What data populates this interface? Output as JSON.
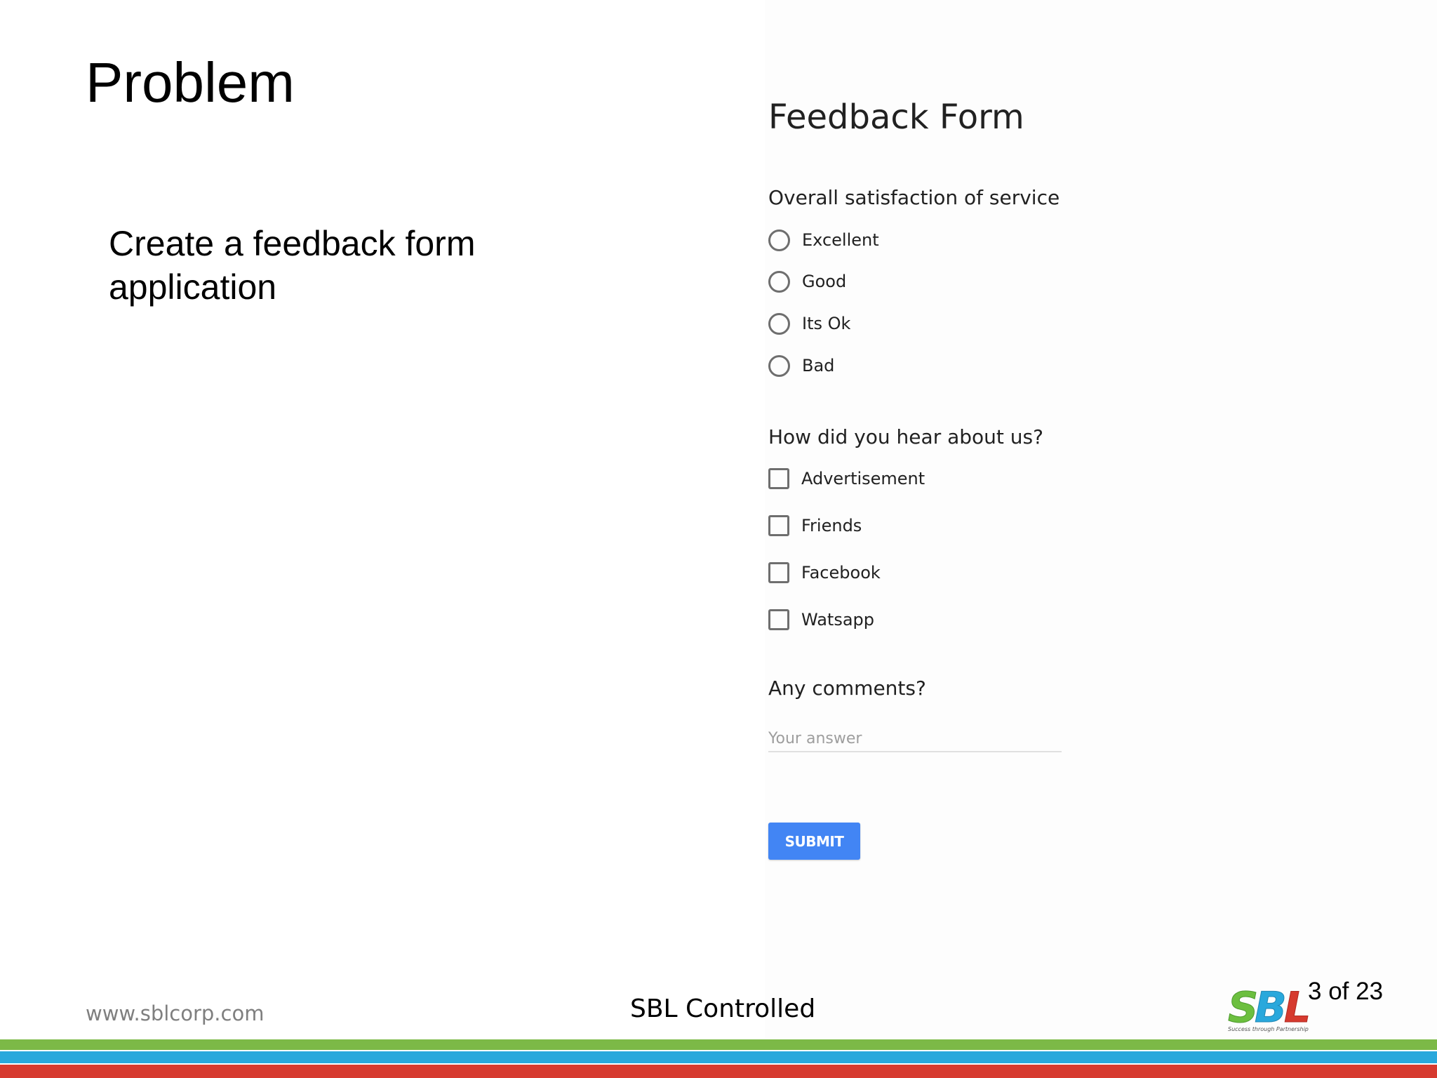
{
  "slide": {
    "title": "Problem",
    "text": "Create a feedback form application",
    "footer_url": "www.sblcorp.com",
    "footer_center": "SBL Controlled",
    "page_number": "3 of 23",
    "logo": {
      "text": "SBL",
      "tagline": "Success through Partnership",
      "colors": [
        "#6cbf3f",
        "#29a8dc",
        "#d63a2f"
      ]
    },
    "stripe_colors": [
      "#7cb947",
      "#29a8dc",
      "#d63a2f"
    ]
  },
  "form": {
    "title": "Feedback Form",
    "q1": {
      "label": "Overall satisfaction of service",
      "options": [
        "Excellent",
        "Good",
        "Its Ok",
        "Bad"
      ]
    },
    "q2": {
      "label": "How did you hear about us?",
      "options": [
        "Advertisement",
        "Friends",
        "Facebook",
        "Watsapp"
      ]
    },
    "q3": {
      "label": "Any comments?",
      "placeholder": "Your answer"
    },
    "submit_label": "SUBMIT",
    "accent_color": "#4285f4"
  }
}
